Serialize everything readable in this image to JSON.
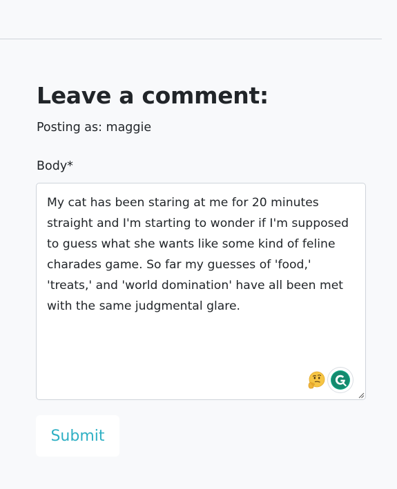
{
  "comment_form": {
    "heading": "Leave a comment:",
    "posting_as": "Posting as: maggie",
    "body_label": "Body*",
    "body_value": "My cat has been staring at me for 20 minutes straight and I'm starting to wonder if I'm supposed to guess what she wants like some kind of feline charades game. So far my guesses of 'food,' 'treats,' and 'world domination' have all been met with the same judgmental glare.",
    "submit_label": "Submit"
  },
  "icons": {
    "emoji": "thinking-face-emoji-icon",
    "extension": "grammarly-icon",
    "resize": "resize-handle-icon"
  },
  "colors": {
    "background": "#f8f9fb",
    "text": "#212529",
    "border": "#cfd4da",
    "submit_text": "#2fb0c4",
    "grammarly": "#15c39a"
  }
}
